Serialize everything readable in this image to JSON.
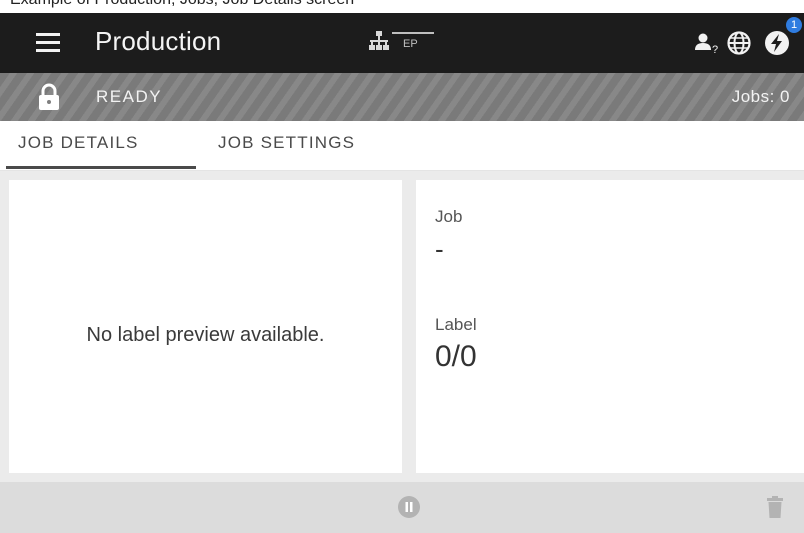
{
  "caption": "Example of Production, Jobs, Job Details screen",
  "header": {
    "menu_icon": "hamburger-menu-icon",
    "title": "Production",
    "network_icon": "network-icon",
    "ep_label": "EP",
    "user_icon": "user-unknown-icon",
    "globe_icon": "globe-icon",
    "power_icon": "lightning-icon",
    "notification_count": "1"
  },
  "status": {
    "lock_icon": "lock-icon",
    "state": "READY",
    "jobs": "Jobs: 0"
  },
  "tabs": [
    {
      "label": "JOB DETAILS",
      "active": true
    },
    {
      "label": "JOB SETTINGS",
      "active": false
    }
  ],
  "preview": {
    "message": "No label preview available."
  },
  "details": {
    "job_label": "Job",
    "job_value": "-",
    "label_label": "Label",
    "label_value": "0/0"
  },
  "footer": {
    "pause_icon": "pause-icon",
    "delete_icon": "trash-icon"
  },
  "colors": {
    "topbar": "#1c1c1c",
    "statusbar": "#7f7f7f",
    "badge": "#2f7ce0",
    "content_bg": "#ebebeb",
    "bottombar": "#dcdcdc"
  }
}
